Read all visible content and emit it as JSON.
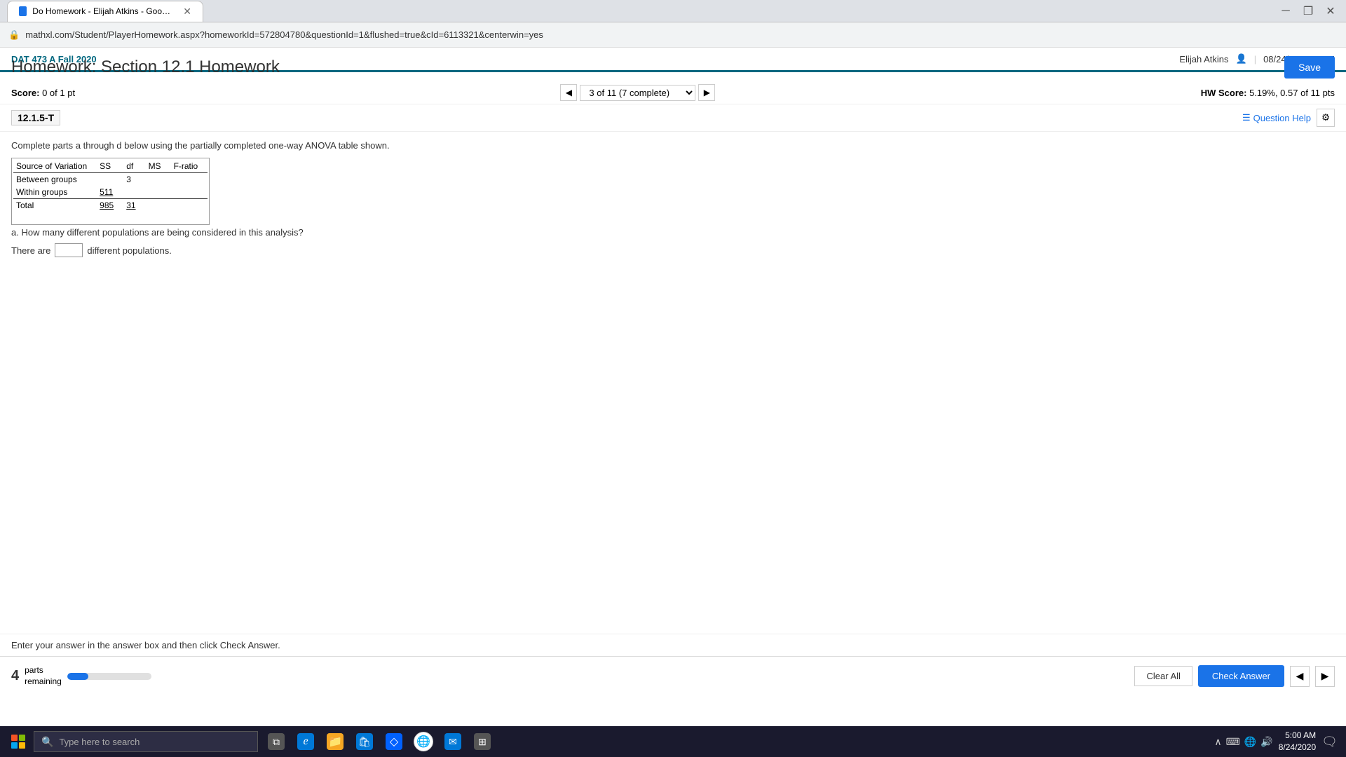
{
  "browser": {
    "titlebar": {
      "tab_title": "Do Homework - Elijah Atkins - Google Chrome"
    },
    "addressbar": {
      "url": "mathxl.com/Student/PlayerHomework.aspx?homeworkId=572804780&questionId=1&flushed=true&cId=6113321&centerwin=yes"
    }
  },
  "app": {
    "course": "DAT 473 A Fall 2020",
    "user": "Elijah Atkins",
    "datetime": "08/24/20 5:00 AM"
  },
  "page": {
    "title": "Homework: Section 12.1 Homework",
    "save_button": "Save",
    "score_label": "Score:",
    "score_value": "0 of 1 pt",
    "nav_text": "3 of 11 (7 complete)",
    "hw_score_label": "HW Score:",
    "hw_score_value": "5.19%, 0.57 of 11 pts"
  },
  "question": {
    "id": "12.1.5-T",
    "help_label": "Question Help",
    "instruction": "Complete parts a through d below using the partially completed one-way ANOVA table shown.",
    "table": {
      "headers": [
        "Source of Variation",
        "SS",
        "df",
        "MS",
        "F-ratio"
      ],
      "rows": [
        [
          "Between groups",
          "",
          "3",
          "",
          ""
        ],
        [
          "Within groups",
          "511",
          "",
          "",
          ""
        ],
        [
          "Total",
          "985",
          "31",
          "",
          ""
        ]
      ]
    },
    "part_a_label": "a. How many different populations are being considered in this analysis?",
    "answer_prefix": "There are",
    "answer_suffix": "different populations.",
    "answer_placeholder": ""
  },
  "footer": {
    "instruction": "Enter your answer in the answer box and then click Check Answer.",
    "parts_remaining_number": "4",
    "parts_remaining_label": "parts\nremaining",
    "progress_percent": 25,
    "clear_all_label": "Clear All",
    "check_answer_label": "Check Answer",
    "help_symbol": "?"
  },
  "taskbar": {
    "search_placeholder": "Type here to search",
    "time": "5:00 AM",
    "date": "8/24/2020",
    "icons": [
      {
        "name": "task-view",
        "symbol": "⧉"
      },
      {
        "name": "edge-browser",
        "symbol": "e"
      },
      {
        "name": "file-explorer",
        "symbol": "📁"
      },
      {
        "name": "store",
        "symbol": "🛍"
      },
      {
        "name": "dropbox",
        "symbol": "◇"
      },
      {
        "name": "chrome",
        "symbol": "●"
      },
      {
        "name": "mail",
        "symbol": "✉"
      },
      {
        "name": "apps",
        "symbol": "⊞"
      }
    ]
  }
}
